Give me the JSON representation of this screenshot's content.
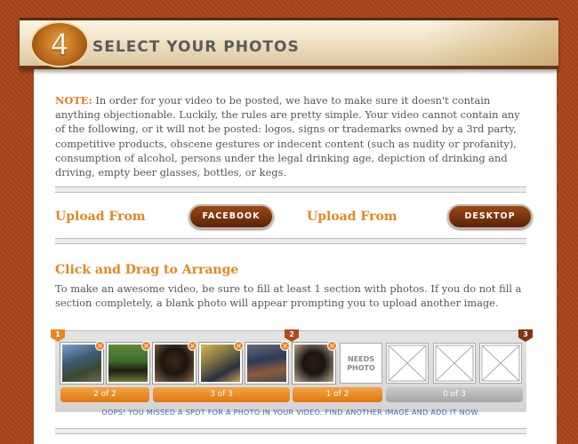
{
  "header": {
    "step": "4",
    "title": "SELECT YOUR PHOTOS"
  },
  "note": {
    "label": "NOTE:",
    "text": "In order for your video to be posted, we have to make sure it doesn't contain anything objectionable. Luckily, the rules are pretty simple. Your video cannot contain any of the following, or it will not be posted: logos, signs or trademarks owned by a 3rd party, competitive products, obscene gestures or indecent content (such as nudity or profanity), consumption of alcohol, persons under the legal drinking age, depiction of drinking and driving, empty beer glasses, bottles, or kegs."
  },
  "upload": {
    "label_1": "Upload From",
    "facebook_button": "FACEBOOK",
    "label_2": "Upload From",
    "desktop_button": "DESKTOP"
  },
  "arrange": {
    "title": "Click and Drag to Arrange",
    "description": "To make an awesome video, be sure to fill at least 1 section with photos. If you do not fill a section completely, a blank photo will appear prompting you to upload another image."
  },
  "strip": {
    "markers": [
      "1",
      "2",
      "3"
    ],
    "remove_glyph": "×",
    "needs_photo_label": "NEEDS PHOTO",
    "sections": [
      {
        "count": "2 of 2",
        "status": "filled"
      },
      {
        "count": "3 of 3",
        "status": "filled"
      },
      {
        "count": "1 of 2",
        "status": "partial"
      },
      {
        "count": "0 of 3",
        "status": "empty"
      }
    ],
    "message": "OOPS! YOU MISSED A SPOT FOR A PHOTO IN YOUR VIDEO. FIND ANOTHER IMAGE AND ADD IT NOW."
  },
  "colors": {
    "accent_orange": "#e08822",
    "button_brown": "#6b2a08",
    "link_blue": "#3f68b7",
    "background_rust": "#a9451a"
  }
}
